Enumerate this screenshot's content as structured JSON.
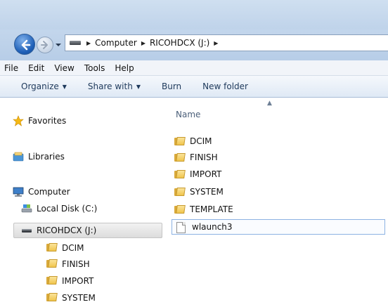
{
  "address": {
    "crumbs": [
      "Computer",
      "RICOHDCX (J:)"
    ]
  },
  "menu": {
    "items": [
      "File",
      "Edit",
      "View",
      "Tools",
      "Help"
    ]
  },
  "toolbar": {
    "organize": "Organize",
    "share_with": "Share with",
    "burn": "Burn",
    "new_folder": "New folder"
  },
  "nav": {
    "favorites": "Favorites",
    "libraries": "Libraries",
    "computer": "Computer",
    "local_disk": "Local Disk (C:)",
    "ricohdcx": "RICOHDCX (J:)",
    "subfolders": [
      "DCIM",
      "FINISH",
      "IMPORT",
      "SYSTEM"
    ]
  },
  "content": {
    "column_header": "Name",
    "folders": [
      "DCIM",
      "FINISH",
      "IMPORT",
      "SYSTEM",
      "TEMPLATE"
    ],
    "file": "wlaunch3"
  },
  "colors": {
    "titlebar": "#cfdff0",
    "toolbar_text": "#1e395b",
    "folder": "#f0c54d",
    "selection_border": "#8db2e3"
  }
}
